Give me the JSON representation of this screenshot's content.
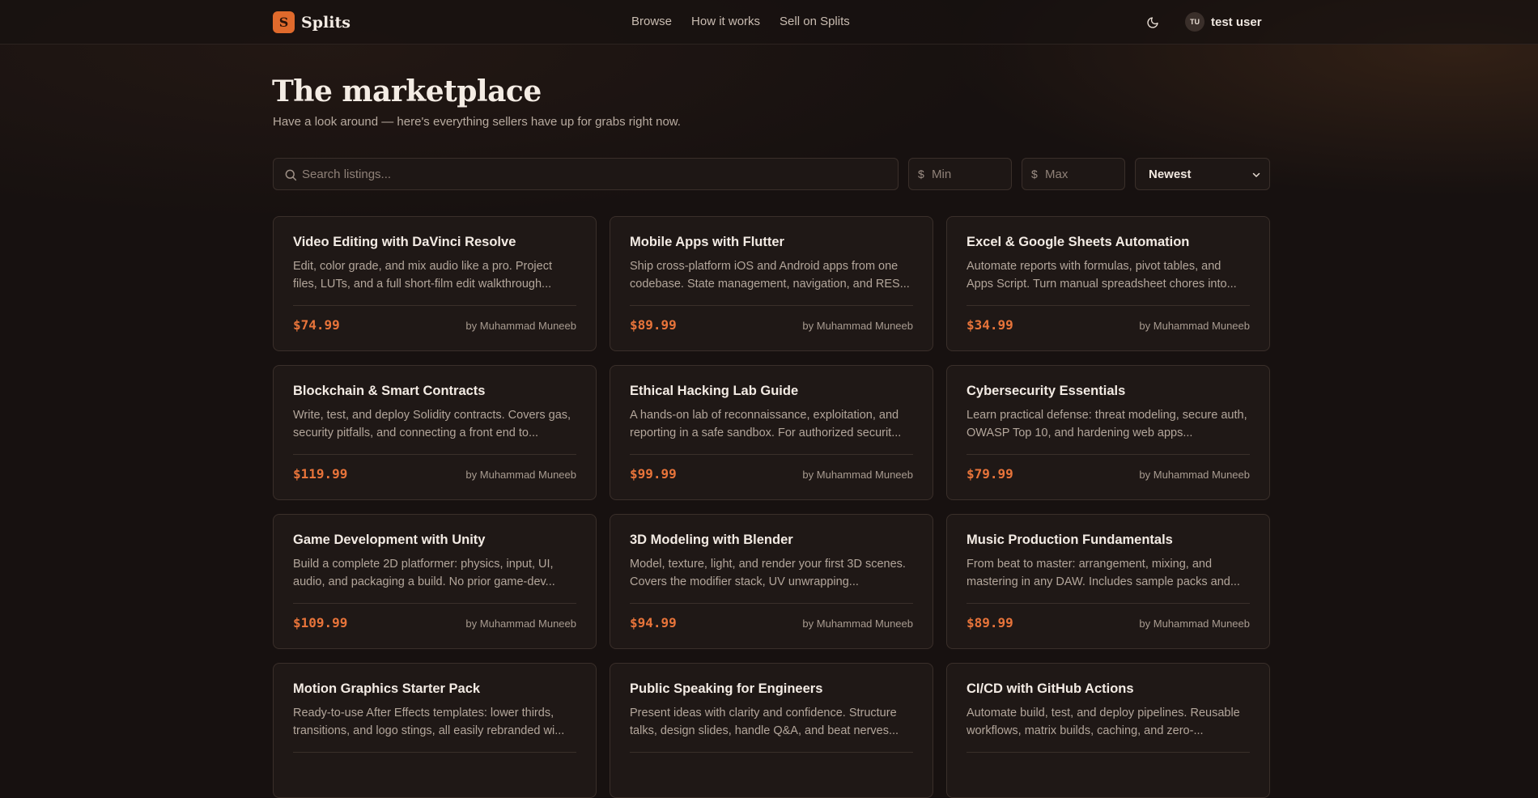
{
  "header": {
    "brand_letter": "S",
    "brand_name": "Splits",
    "nav": [
      "Browse",
      "How it works",
      "Sell on Splits"
    ],
    "theme_icon": "moon-icon",
    "user_initials": "TU",
    "user_name": "test user"
  },
  "main": {
    "title": "The marketplace",
    "subtitle": "Have a look around — here's everything sellers have up for grabs right now."
  },
  "filters": {
    "search_placeholder": "Search listings...",
    "currency_symbol": "$",
    "min_placeholder": "Min",
    "max_placeholder": "Max",
    "sort_selected": "Newest"
  },
  "listings": [
    {
      "title": "Video Editing with DaVinci Resolve",
      "description": "Edit, color grade, and mix audio like a pro. Project files, LUTs, and a full short-film edit walkthrough...",
      "price": "$74.99",
      "seller": "by Muhammad Muneeb"
    },
    {
      "title": "Mobile Apps with Flutter",
      "description": "Ship cross-platform iOS and Android apps from one codebase. State management, navigation, and RES...",
      "price": "$89.99",
      "seller": "by Muhammad Muneeb"
    },
    {
      "title": "Excel & Google Sheets Automation",
      "description": "Automate reports with formulas, pivot tables, and Apps Script. Turn manual spreadsheet chores into...",
      "price": "$34.99",
      "seller": "by Muhammad Muneeb"
    },
    {
      "title": "Blockchain & Smart Contracts",
      "description": "Write, test, and deploy Solidity contracts. Covers gas, security pitfalls, and connecting a front end to...",
      "price": "$119.99",
      "seller": "by Muhammad Muneeb"
    },
    {
      "title": "Ethical Hacking Lab Guide",
      "description": "A hands-on lab of reconnaissance, exploitation, and reporting in a safe sandbox. For authorized securit...",
      "price": "$99.99",
      "seller": "by Muhammad Muneeb"
    },
    {
      "title": "Cybersecurity Essentials",
      "description": "Learn practical defense: threat modeling, secure auth, OWASP Top 10, and hardening web apps...",
      "price": "$79.99",
      "seller": "by Muhammad Muneeb"
    },
    {
      "title": "Game Development with Unity",
      "description": "Build a complete 2D platformer: physics, input, UI, audio, and packaging a build. No prior game-dev...",
      "price": "$109.99",
      "seller": "by Muhammad Muneeb"
    },
    {
      "title": "3D Modeling with Blender",
      "description": "Model, texture, light, and render your first 3D scenes. Covers the modifier stack, UV unwrapping...",
      "price": "$94.99",
      "seller": "by Muhammad Muneeb"
    },
    {
      "title": "Music Production Fundamentals",
      "description": "From beat to master: arrangement, mixing, and mastering in any DAW. Includes sample packs and...",
      "price": "$89.99",
      "seller": "by Muhammad Muneeb"
    },
    {
      "title": "Motion Graphics Starter Pack",
      "description": "Ready-to-use After Effects templates: lower thirds, transitions, and logo stings, all easily rebranded wi...",
      "price": "",
      "seller": ""
    },
    {
      "title": "Public Speaking for Engineers",
      "description": "Present ideas with clarity and confidence. Structure talks, design slides, handle Q&A, and beat nerves...",
      "price": "",
      "seller": ""
    },
    {
      "title": "CI/CD with GitHub Actions",
      "description": "Automate build, test, and deploy pipelines. Reusable workflows, matrix builds, caching, and zero-...",
      "price": "",
      "seller": ""
    }
  ],
  "colors": {
    "accent": "#e06a2c",
    "price": "#e8743a",
    "background": "#171110",
    "card": "#1f1816"
  }
}
